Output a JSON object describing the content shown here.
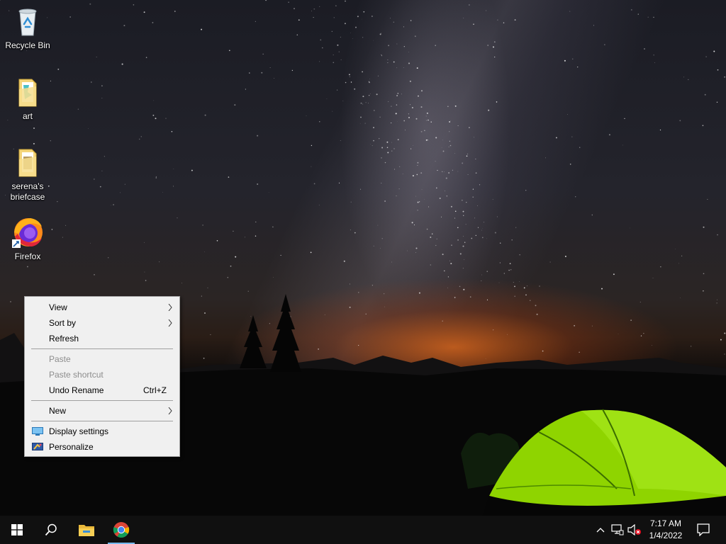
{
  "desktop": {
    "icons": [
      {
        "label": "Recycle Bin",
        "icon": "recycle-bin-icon"
      },
      {
        "label": "art",
        "icon": "folder-icon"
      },
      {
        "label": "serena's briefcase",
        "icon": "folder-icon"
      },
      {
        "label": "Firefox",
        "icon": "firefox-icon"
      }
    ]
  },
  "context_menu": {
    "view": "View",
    "sort_by": "Sort by",
    "refresh": "Refresh",
    "paste": "Paste",
    "paste_shortcut": "Paste shortcut",
    "undo_rename": "Undo Rename",
    "undo_shortcut": "Ctrl+Z",
    "new": "New",
    "display_settings": "Display settings",
    "personalize": "Personalize"
  },
  "taskbar": {
    "apps": [
      {
        "name": "Start",
        "icon": "windows-logo-icon"
      },
      {
        "name": "Search",
        "icon": "search-icon"
      },
      {
        "name": "File Explorer",
        "icon": "file-explorer-icon"
      },
      {
        "name": "Google Chrome",
        "icon": "chrome-icon",
        "active": true
      }
    ],
    "tray": {
      "time": "7:17 AM",
      "date": "1/4/2022"
    }
  },
  "colors": {
    "menu_bg": "#f0f0f0",
    "taskbar_bg": "#101010",
    "accent": "#76b9ed",
    "tent": "#8fd400"
  }
}
